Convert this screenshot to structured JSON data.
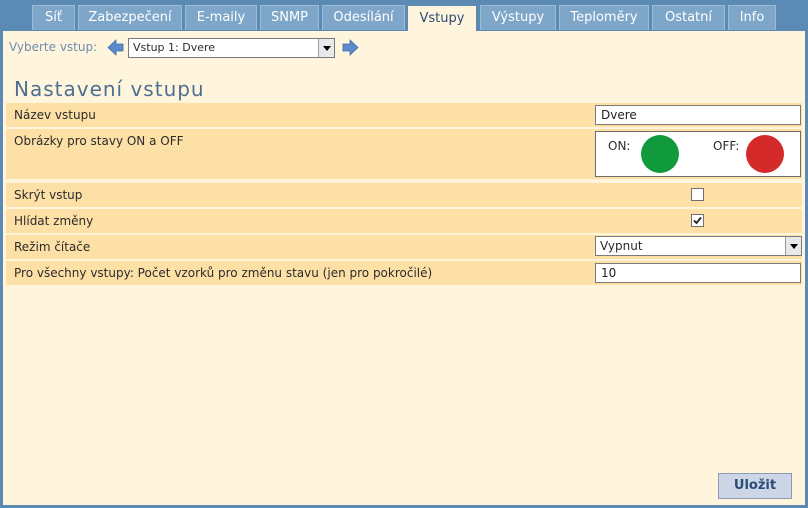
{
  "tabs": [
    {
      "label": "Síť",
      "active": false
    },
    {
      "label": "Zabezpečení",
      "active": false
    },
    {
      "label": "E-maily",
      "active": false
    },
    {
      "label": "SNMP",
      "active": false
    },
    {
      "label": "Odesílání",
      "active": false
    },
    {
      "label": "Vstupy",
      "active": true
    },
    {
      "label": "Výstupy",
      "active": false
    },
    {
      "label": "Teploměry",
      "active": false
    },
    {
      "label": "Ostatní",
      "active": false
    },
    {
      "label": "Info",
      "active": false
    }
  ],
  "selector": {
    "label": "Vyberte vstup:",
    "value": "Vstup 1: Dvere",
    "prev_icon": "arrow-left-icon",
    "next_icon": "arrow-right-icon"
  },
  "section_title": "Nastavení vstupu",
  "form": {
    "name": {
      "label": "Název vstupu",
      "value": "Dvere"
    },
    "images": {
      "label": "Obrázky pro stavy ON a OFF",
      "on_label": "ON:",
      "off_label": "OFF:",
      "on_color": "#119a3c",
      "off_color": "#d42a2a"
    },
    "hide": {
      "label": "Skrýt vstup",
      "checked": false
    },
    "watch": {
      "label": "Hlídat změny",
      "checked": true
    },
    "counter_mode": {
      "label": "Režim čítače",
      "value": "Vypnut"
    },
    "samples": {
      "label": "Pro všechny vstupy: Počet vzorků pro změnu stavu (jen pro pokročilé)",
      "value": "10"
    }
  },
  "save_button": "Uložit",
  "colors": {
    "frame": "#5b8bb4",
    "panel": "#fff5dc",
    "row": "#fde0a6",
    "tab": "#7ea6c9"
  }
}
